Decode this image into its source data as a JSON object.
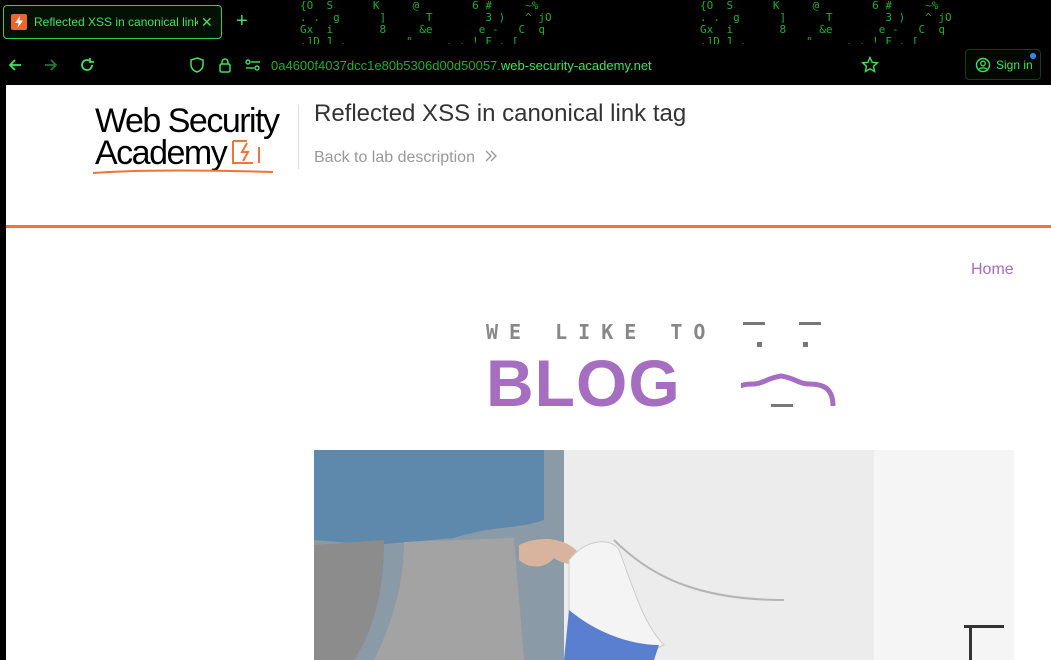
{
  "browser": {
    "tab_title": "Reflected XSS in canonical link tag",
    "new_tab": "+",
    "close": "✕",
    "url_prefix": "0a4600f4037dcc1e80b5306d00d50057.",
    "url_host": "web-security-academy.net",
    "sign_in": "Sign in",
    "matrix_left": "{O  S      K     @        6 #     ~%\n. .  g      ]      T        3 )   ^ jO\nGx  i       8     &e       e -   C  q\n.]D 1 .         \"     . . ! F . [",
    "matrix_right": "{O  S      K     @        6 #     ~%\n. .  g      ]      T        3 )   ^ jO\nGx  i       8     &e       e -   C  q\n.]D 1 .         \"     . . ! F . ["
  },
  "header": {
    "logo_line1": "Web Security",
    "logo_line2": "Academy",
    "lab_title": "Reflected XSS in canonical link tag",
    "back_link": "Back to lab description"
  },
  "nav": {
    "home": "Home"
  },
  "banner": {
    "tagline": "WE LIKE TO",
    "word": "BLOG"
  },
  "colors": {
    "accent_orange": "#f0733a",
    "blog_purple": "#a56ec0",
    "browser_green": "#3fe25a"
  }
}
